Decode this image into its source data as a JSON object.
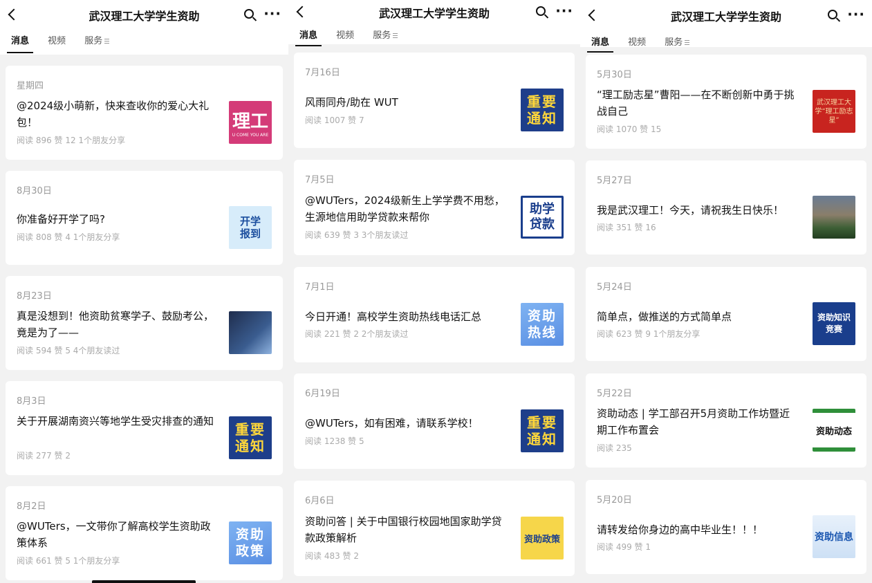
{
  "panels": [
    {
      "title": "武汉理工大学学生资助",
      "tabs": [
        "消息",
        "视频",
        "服务"
      ],
      "articles": [
        {
          "date": "星期四",
          "title": "@2024级小萌新，快来查收你的爱心大礼包！",
          "meta": "阅读 896  赞 12  1个朋友分享",
          "thumb_text": "理工",
          "thumb_sub": "U COME YOU ARE"
        },
        {
          "date": "8月30日",
          "title": "你准备好开学了吗?",
          "meta": "阅读 808  赞 4  1个朋友分享",
          "thumb_text": "开学报到"
        },
        {
          "date": "8月23日",
          "title": "真是没想到！他资助贫寒学子、鼓励考公，竟是为了——",
          "meta": "阅读 594  赞 5  4个朋友读过",
          "thumb_text": ""
        },
        {
          "date": "8月3日",
          "title": "关于开展湖南资兴等地学生受灾排查的通知",
          "meta": "阅读 277  赞 2",
          "thumb_text": "重要通知"
        },
        {
          "date": "8月2日",
          "title": "@WUTers，一文带你了解高校学生资助政策体系",
          "meta": "阅读 661  赞 5  1个朋友分享",
          "thumb_text": "资助政策"
        }
      ]
    },
    {
      "title": "武汉理工大学学生资助",
      "tabs": [
        "消息",
        "视频",
        "服务"
      ],
      "articles": [
        {
          "date": "7月16日",
          "title": "风雨同舟/助在 WUT",
          "meta": "阅读 1007  赞 7",
          "thumb_text": "重要通知"
        },
        {
          "date": "7月5日",
          "title": "@WUTers，2024级新生上学学费不用愁，生源地信用助学贷款来帮你",
          "meta": "阅读 639  赞 3  3个朋友读过",
          "thumb_text": "助学贷款"
        },
        {
          "date": "7月1日",
          "title": "今日开通！高校学生资助热线电话汇总",
          "meta": "阅读 221  赞 2  2个朋友读过",
          "thumb_text": "资助热线"
        },
        {
          "date": "6月19日",
          "title": "@WUTers，如有困难，请联系学校！",
          "meta": "阅读 1238  赞 5",
          "thumb_text": "重要通知"
        },
        {
          "date": "6月6日",
          "title": "资助问答 | 关于中国银行校园地国家助学贷款政策解析",
          "meta": "阅读 483  赞 2",
          "thumb_text": "资助政策"
        }
      ]
    },
    {
      "title": "武汉理工大学学生资助",
      "tabs": [
        "消息",
        "视频",
        "服务"
      ],
      "articles": [
        {
          "date": "5月30日",
          "title": "“理工励志星”曹阳——在不断创新中勇于挑战自己",
          "meta": "阅读 1070  赞 15",
          "thumb_text": "武汉理工大学“理工励志星”"
        },
        {
          "date": "5月27日",
          "title": "我是武汉理工！今天，请祝我生日快乐！",
          "meta": "阅读 351  赞 16",
          "thumb_text": ""
        },
        {
          "date": "5月24日",
          "title": "简单点，做推送的方式简单点",
          "meta": "阅读 623  赞 9  1个朋友分享",
          "thumb_text": "资助知识竞赛"
        },
        {
          "date": "5月22日",
          "title": "资助动态 | 学工部召开5月资助工作坊暨近期工作布置会",
          "meta": "阅读 235",
          "thumb_text": "资助动态"
        },
        {
          "date": "5月20日",
          "title": "请转发给你身边的高中毕业生！！！",
          "meta": "阅读 499  赞 1",
          "thumb_text": "资助信息"
        }
      ]
    }
  ]
}
